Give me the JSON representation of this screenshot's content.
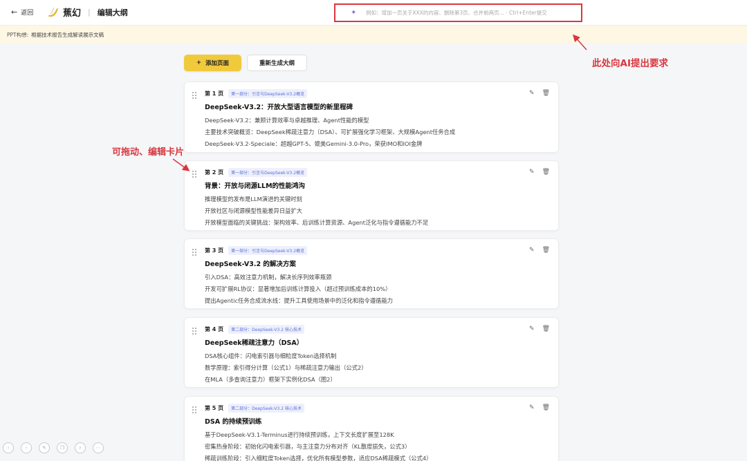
{
  "header": {
    "back_label": "返回",
    "brand_name": "蕉幻",
    "separator": "|",
    "page_title": "编辑大纲",
    "ai_placeholder": "例如：增加一页关于XXX的内容、删除第3页、合并前两页... · Ctrl+Enter提交"
  },
  "banner": {
    "label": "PPT构想:",
    "text": "根据技术报告生成解读展示文稿"
  },
  "toolbar": {
    "add_label": "添加页面",
    "regen_label": "重新生成大纲"
  },
  "annotations": {
    "ai_hint": "此处向AI提出要求",
    "drag_hint": "可拖动、编辑卡片"
  },
  "cards": [
    {
      "page": "第 1 页",
      "tag": "第一部分：引言与DeepSeek-V3.2概览",
      "title": "DeepSeek-V3.2：开放大型语言模型的新里程碑",
      "points": [
        "DeepSeek-V3.2：兼顾计算效率与卓越推理、Agent性能的模型",
        "主要技术突破概览：DeepSeek稀疏注意力（DSA）、可扩展强化学习框架、大规模Agent任务合成",
        "DeepSeek-V3.2-Speciale：超越GPT-5、媲美Gemini-3.0-Pro，荣获IMO和IOI金牌"
      ]
    },
    {
      "page": "第 2 页",
      "tag": "第一部分：引言与DeepSeek-V3.2概览",
      "title": "背景：开放与闭源LLM的性能鸿沟",
      "points": [
        "推理模型的发布是LLM演进的关键时刻",
        "开放社区与闭源模型性能差异日益扩大",
        "开放模型面临的关键挑战：架构效率、后训练计算资源、Agent泛化与指令遵循能力不足"
      ]
    },
    {
      "page": "第 3 页",
      "tag": "第一部分：引言与DeepSeek-V3.2概览",
      "title": "DeepSeek-V3.2 的解决方案",
      "points": [
        "引入DSA：高效注意力机制，解决长序列效率瓶颈",
        "开发可扩展RL协议：显著增加后训练计算投入（超过预训练成本的10%）",
        "提出Agentic任务合成流水线：提升工具使用场景中的泛化和指令遵循能力"
      ]
    },
    {
      "page": "第 4 页",
      "tag": "第二部分：DeepSeek-V3.2 核心技术",
      "title": "DeepSeek稀疏注意力（DSA）",
      "points": [
        "DSA核心组件：闪电索引器与细粒度Token选择机制",
        "数学原理：索引得分计算（公式1）与稀疏注意力输出（公式2）",
        "在MLA（多查询注意力）框架下实例化DSA（图2）"
      ]
    },
    {
      "page": "第 5 页",
      "tag": "第二部分：DeepSeek-V3.2 核心技术",
      "title": "DSA 的持续预训练",
      "points": [
        "基于DeepSeek-V3.1-Terminus进行持续预训练，上下文长度扩展至128K",
        "密集热身阶段：初始化闪电索引器，与主注意力分布对齐（KL散度损失，公式3）",
        "稀疏训练阶段：引入细粒度Token选择，优化所有模型参数，适应DSA稀疏模式（公式4）"
      ]
    }
  ]
}
